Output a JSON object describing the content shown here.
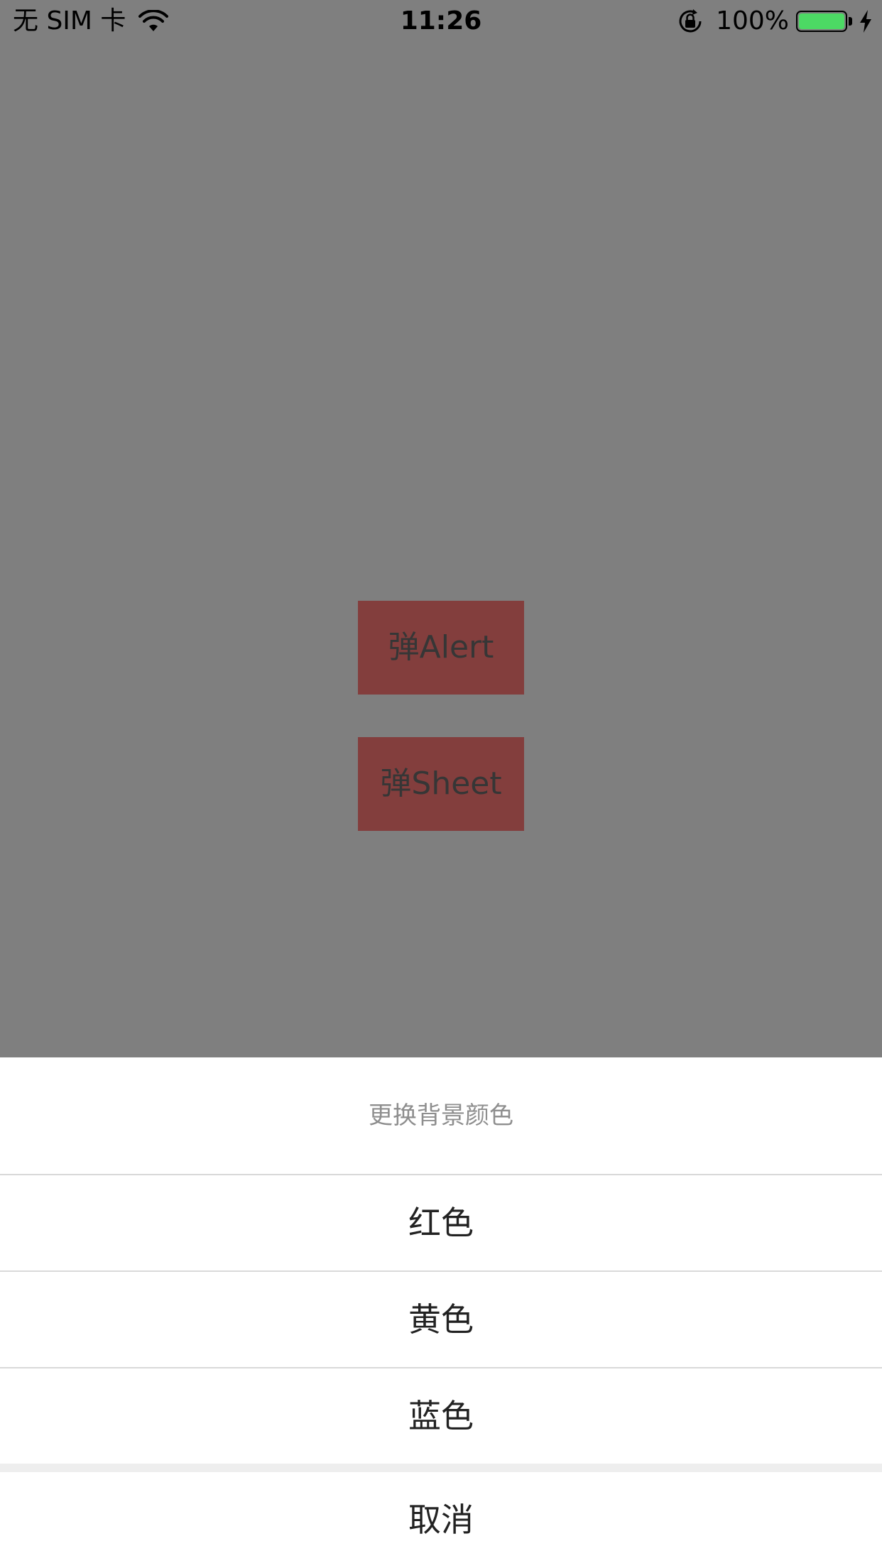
{
  "status_bar": {
    "carrier": "无 SIM 卡",
    "time": "11:26",
    "battery_percent": "100%",
    "battery_level": 1.0,
    "battery_color": "#4cd964",
    "icons": [
      "wifi-icon",
      "rotation-lock-icon",
      "battery-icon",
      "charging-bolt-icon"
    ]
  },
  "main": {
    "alert_button_label": "弹Alert",
    "sheet_button_label": "弹Sheet",
    "button_color": "#833e3d",
    "background_color": "#7f7f7f"
  },
  "action_sheet": {
    "title": "更换背景颜色",
    "options": [
      "红色",
      "黄色",
      "蓝色"
    ],
    "cancel_label": "取消"
  }
}
